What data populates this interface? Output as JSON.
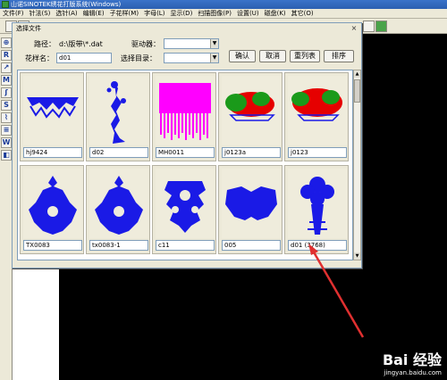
{
  "app": {
    "title": "山诺SINOTEK绣花打版系统(Windows)"
  },
  "menu": [
    "文件(F)",
    "针法(S)",
    "选针(A)",
    "编辑(E)",
    "子花样(M)",
    "字母(L)",
    "显示(D)",
    "扫描图像(P)",
    "设置(U)",
    "磁盘(K)",
    "其它(O)"
  ],
  "left_tools": [
    "⊕",
    "R",
    "↗",
    "M",
    "ʃ",
    "S",
    "⌇",
    "≡",
    "W",
    "◧"
  ],
  "dialog": {
    "title": "选择文件",
    "close": "×",
    "path_label": "路径：",
    "path_value": "d:\\版带\\*.dat",
    "name_label": "花样名：",
    "name_value": "d01",
    "drive_label": "驱动器：",
    "dir_label": "选择目录：",
    "buttons": {
      "ok": "确认",
      "cancel": "取消",
      "refresh": "重列表",
      "sort": "排序"
    }
  },
  "files": [
    {
      "name": "hj9424",
      "shape": "lace",
      "color": "#1a1ae6"
    },
    {
      "name": "d02",
      "shape": "vine",
      "color": "#1a1ae6"
    },
    {
      "name": "MH0011",
      "shape": "fringe",
      "color": "#ff00ff"
    },
    {
      "name": "j0123a",
      "shape": "bush",
      "color": "#e60000"
    },
    {
      "name": "j0123",
      "shape": "bush2",
      "color": "#e60000"
    },
    {
      "name": "TX0083",
      "shape": "dome",
      "color": "#1a1ae6"
    },
    {
      "name": "tx0083-1",
      "shape": "dome",
      "color": "#1a1ae6"
    },
    {
      "name": "c11",
      "shape": "cross",
      "color": "#1a1ae6"
    },
    {
      "name": "005",
      "shape": "collar",
      "color": "#1a1ae6"
    },
    {
      "name": "d01  (3768)",
      "shape": "tree",
      "color": "#1a1ae6"
    }
  ],
  "watermark": {
    "brand": "Bai 经验",
    "url": "jingyan.baidu.com"
  }
}
